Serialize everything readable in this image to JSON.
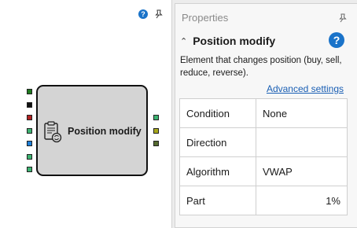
{
  "canvas": {
    "help_icon": "help-icon",
    "pin_icon": "pin-icon"
  },
  "node": {
    "label": "Position modify",
    "icon": "clipboard-refresh-icon",
    "left_port_colors": [
      "#1f7a1f",
      "#111111",
      "#b22222",
      "#3cb371",
      "#1e7fd8",
      "#3cb371",
      "#3cb371"
    ],
    "right_port_colors": [
      "#3cb371",
      "#a8a81a",
      "#556b2f"
    ]
  },
  "properties": {
    "header": "Properties",
    "section_title": "Position modify",
    "description": "Element that changes position (buy, sell, reduce, reverse).",
    "advanced_link": "Advanced settings",
    "rows": [
      {
        "key": "Condition",
        "value": "None"
      },
      {
        "key": "Direction",
        "value": ""
      },
      {
        "key": "Algorithm",
        "value": "VWAP"
      },
      {
        "key": "Part",
        "value": "1%"
      }
    ]
  }
}
